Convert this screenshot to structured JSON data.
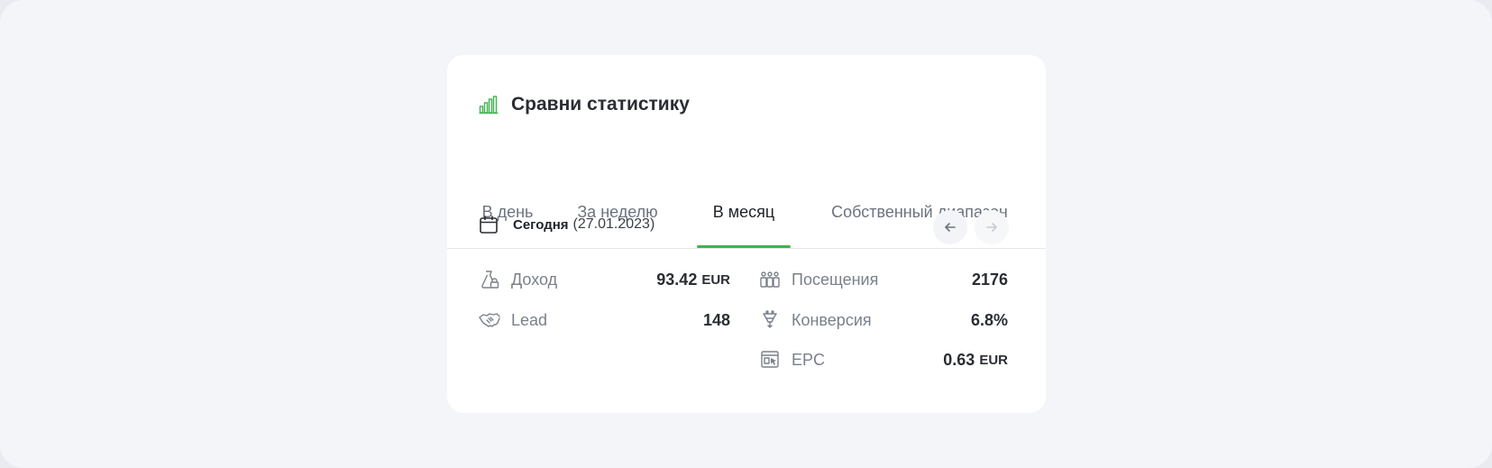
{
  "header": {
    "title": "Сравни статистику",
    "icon": "bar-chart-icon",
    "icon_color": "#3fb34f"
  },
  "tabs": [
    {
      "label": "В день",
      "active": false
    },
    {
      "label": "За неделю",
      "active": false
    },
    {
      "label": "В месяц",
      "active": true
    },
    {
      "label": "Собственный диапазон",
      "active": false
    }
  ],
  "accent_color": "#3fb34f",
  "date": {
    "icon": "calendar-icon",
    "strong": "Сегодня",
    "value": "(27.01.2023)"
  },
  "navigation": {
    "prev_icon": "arrow-left-icon",
    "next_icon": "arrow-right-icon"
  },
  "stats": {
    "income": {
      "label": "Доход",
      "value": "93.42",
      "unit": "EUR",
      "icon": "money-bag-icon"
    },
    "lead": {
      "label": "Lead",
      "value": "148",
      "unit": "",
      "icon": "handshake-icon"
    },
    "visits": {
      "label": "Посещения",
      "value": "2176",
      "unit": "",
      "icon": "visitors-icon"
    },
    "conversion": {
      "label": "Конверсия",
      "value": "6.8%",
      "unit": "",
      "icon": "funnel-icon"
    },
    "epc": {
      "label": "EPC",
      "value": "0.63",
      "unit": "EUR",
      "icon": "click-cursor-icon"
    }
  }
}
